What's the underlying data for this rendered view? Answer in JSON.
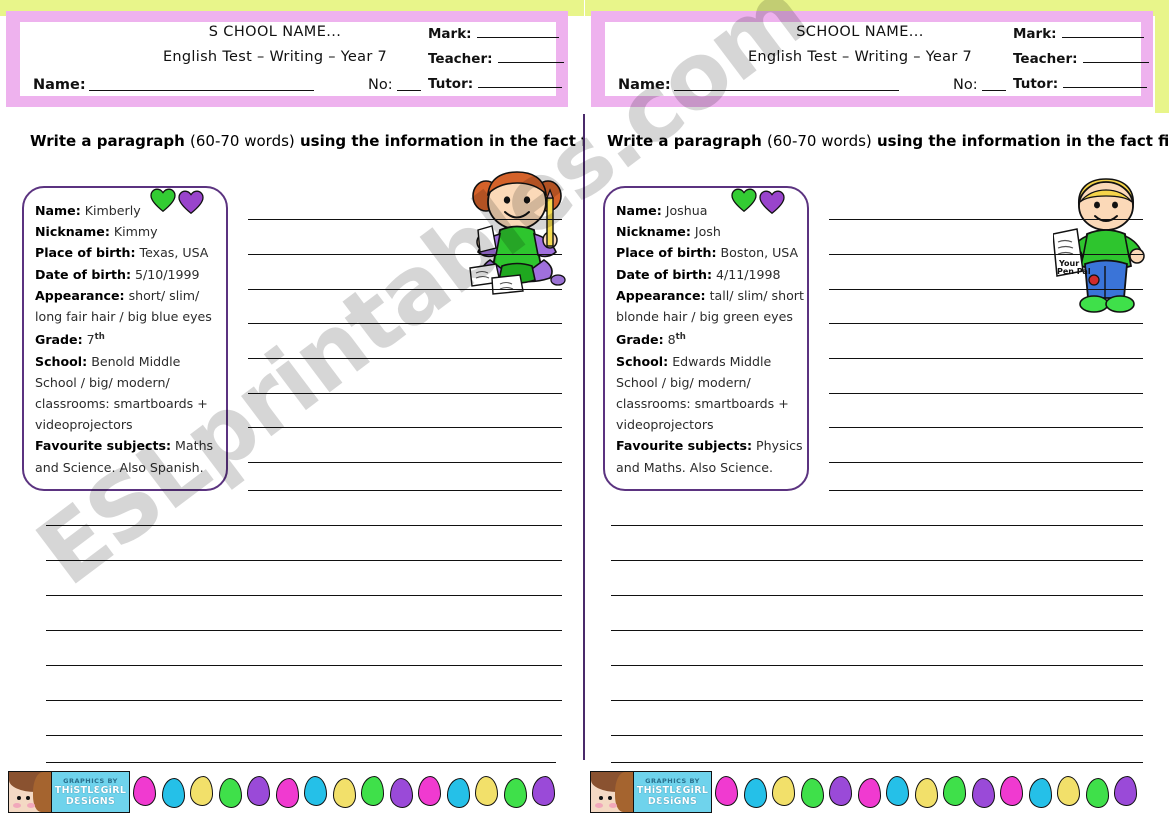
{
  "meta": {
    "watermark": "ESLprintables.com"
  },
  "colors": {
    "border_pink": "#eeb2ee",
    "border_green": "#e8f58a",
    "factbox_purple": "#5b3380",
    "heart_green": "#33cc33",
    "heart_purple": "#9944cc",
    "logo_cyan": "#6fd3ec"
  },
  "panels": [
    {
      "id": "left",
      "header": {
        "school_name": "S CHOOL NAME...",
        "test_title": "English Test – Writing – Year 7",
        "name_label": "Name:",
        "no_label": "No:",
        "fields": [
          {
            "label": "Mark:",
            "name": "mark-field"
          },
          {
            "label": "Teacher:",
            "name": "teacher-field"
          },
          {
            "label": "Tutor:",
            "name": "tutor-field"
          }
        ]
      },
      "instruction": {
        "bold_1": "Write a paragraph ",
        "light": "(60-70 words)",
        "bold_2": " using the information in the fact file."
      },
      "factfile": {
        "rows": [
          {
            "label": "Name:",
            "value": "Kimberly"
          },
          {
            "label": "Nickname:",
            "value": "Kimmy"
          },
          {
            "label": "Place of birth:",
            "value": "Texas, USA"
          },
          {
            "label": "Date of birth:",
            "value": "5/10/1999"
          },
          {
            "label": "Appearance:",
            "value": "short/ slim/ long fair hair / big blue eyes"
          },
          {
            "label": "Grade:",
            "value": "7",
            "sup": "th"
          },
          {
            "label": "School:",
            "value": "Benold Middle School / big/ modern/ classrooms: smartboards + videoprojectors"
          },
          {
            "label": "Favourite subjects:",
            "value": "Maths and Science. Also Spanish."
          }
        ]
      },
      "clipart": {
        "name": "girl-writing-clipart",
        "alt": "Girl with red pigtails holding a pencil"
      }
    },
    {
      "id": "right",
      "header": {
        "school_name": "SCHOOL NAME...",
        "test_title": "English Test – Writing – Year 7",
        "name_label": "Name:",
        "no_label": "No:",
        "fields": [
          {
            "label": "Mark:",
            "name": "mark-field"
          },
          {
            "label": "Teacher:",
            "name": "teacher-field"
          },
          {
            "label": "Tutor:",
            "name": "tutor-field"
          }
        ]
      },
      "instruction": {
        "bold_1": "Write a paragraph ",
        "light": "(60-70 words)",
        "bold_2": " using the information in the fact file."
      },
      "factfile": {
        "rows": [
          {
            "label": "Name:",
            "value": "Joshua"
          },
          {
            "label": "Nickname:",
            "value": "Josh"
          },
          {
            "label": "Place of birth:",
            "value": "Boston, USA"
          },
          {
            "label": "Date of birth:",
            "value": "4/11/1998"
          },
          {
            "label": "Appearance:",
            "value": "tall/ slim/ short blonde hair / big green eyes"
          },
          {
            "label": "Grade:",
            "value": "8",
            "sup": "th"
          },
          {
            "label": "School:",
            "value": "Edwards Middle School / big/ modern/ classrooms: smartboards + videoprojectors"
          },
          {
            "label": "Favourite subjects:",
            "value": "Physics and Maths. Also Science."
          }
        ]
      },
      "clipart": {
        "name": "boy-penpal-clipart",
        "alt": "Blond boy in overalls holding a letter",
        "letter_line1": "Your",
        "letter_line2": "Pen Pal"
      }
    }
  ],
  "footer": {
    "logo": {
      "line1": "GRAPHICS BY",
      "line2": "THiSTLƐGiRL",
      "line3": "DƐSiGNS"
    },
    "egg_colors": [
      "#f03ad0",
      "#25c0e8",
      "#f2e06a",
      "#3fe04a",
      "#9a4ad8"
    ],
    "egg_count": 15
  }
}
